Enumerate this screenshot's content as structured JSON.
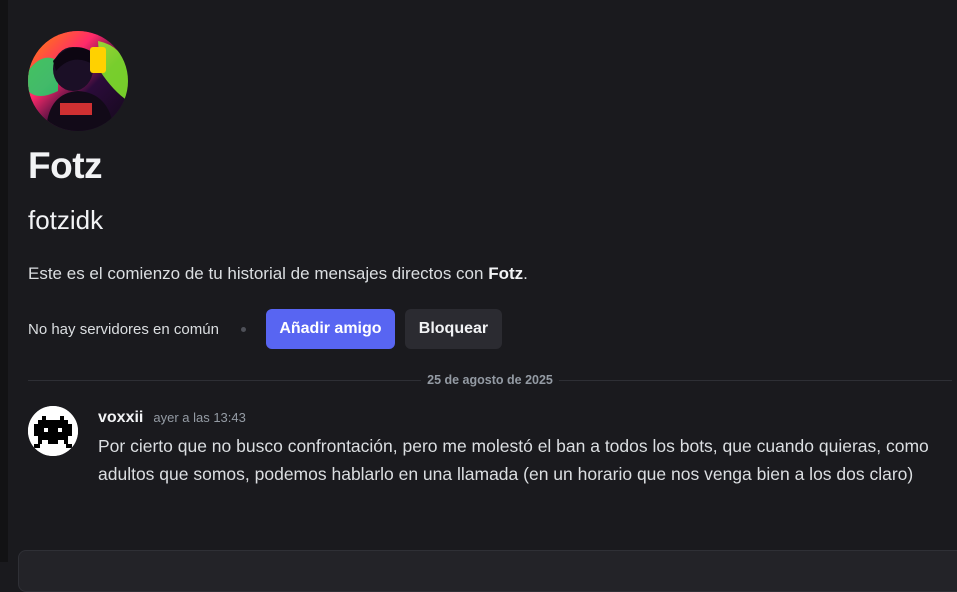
{
  "profile": {
    "display_name": "Fotz",
    "username": "fotzidk",
    "intro_prefix": "Este es el comienzo de tu historial de mensajes directos con ",
    "intro_name": "Fotz",
    "intro_suffix": "."
  },
  "actions": {
    "mutual_servers": "No hay servidores en común",
    "add_friend_label": "Añadir amigo",
    "block_label": "Bloquear"
  },
  "divider": {
    "date": "25 de agosto de 2025"
  },
  "message": {
    "author": "voxxii",
    "timestamp": "ayer a las 13:43",
    "text": "Por cierto que no busco confrontación, pero me molestó el ban a todos los bots, que cuando quieras, como adultos que somos, podemos hablarlo en una llamada (en un horario que nos venga bien a los dos claro)"
  },
  "colors": {
    "background": "#1a1a1e",
    "accent": "#5865f2",
    "secondary_button": "#2b2b31",
    "muted_text": "#949ba4"
  },
  "icons": {
    "profile_avatar": "profile-avatar-image",
    "message_avatar": "pixel-space-invader-avatar"
  }
}
